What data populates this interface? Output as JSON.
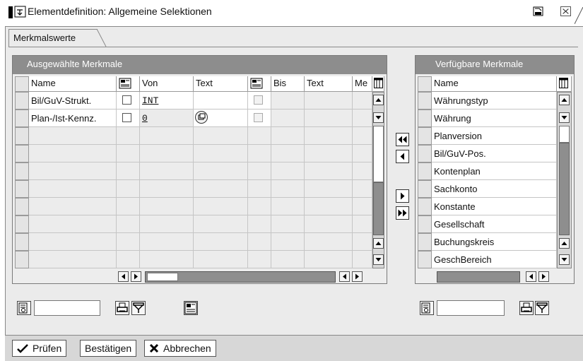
{
  "window": {
    "title": "Elementdefinition: Allgemeine Selektionen"
  },
  "tab": {
    "label": "Merkmalswerte"
  },
  "left_panel": {
    "title": "Ausgewählte Merkmale",
    "columns": [
      "Name",
      "Von",
      "Text",
      "Bis",
      "Text",
      "Me"
    ],
    "rows": [
      {
        "name": "Bil/GuV-Strukt.",
        "von": "INT",
        "text": "",
        "bis": "",
        "text2": ""
      },
      {
        "name": "Plan-/Ist-Kennz.",
        "von": "0",
        "text": "",
        "bis": "",
        "text2": ""
      }
    ],
    "empty_rows": 8
  },
  "right_panel": {
    "title": "Verfügbare Merkmale",
    "column": "Name",
    "items": [
      "Währungstyp",
      "Währung",
      "Planversion",
      "Bil/GuV-Pos.",
      "Kontenplan",
      "Sachkonto",
      "Konstante",
      "Gesellschaft",
      "Buchungskreis",
      "GeschBereich"
    ]
  },
  "footer": {
    "check_label": "Prüfen",
    "confirm_label": "Bestätigen",
    "cancel_label": "Abbrechen"
  },
  "icons": {
    "title": "window-icon",
    "check": "checkmark-icon",
    "cancel": "cross-icon"
  },
  "colors": {
    "group_header": "#8d8d8d",
    "workspace": "#ebebeb",
    "footer": "#d7d7d7"
  }
}
